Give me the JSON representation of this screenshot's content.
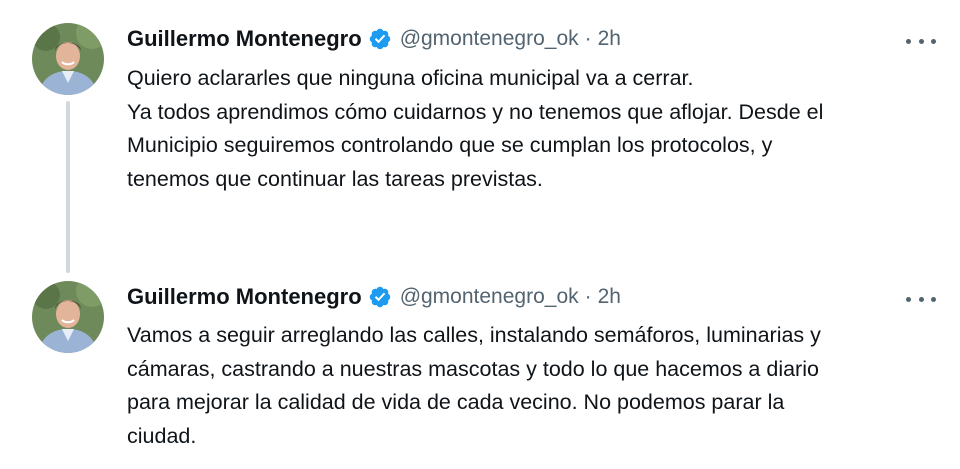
{
  "tweets": [
    {
      "author": {
        "name": "Guillermo Montenegro",
        "handle": "@gmontenegro_ok",
        "verified": true
      },
      "separator": "·",
      "time": "2h",
      "text_lines": [
        "Quiero aclararles que ninguna oficina municipal va a cerrar.",
        "Ya todos aprendimos cómo cuidarnos y no tenemos que aflojar. Desde el",
        "Municipio seguiremos controlando que se cumplan los protocolos, y",
        "tenemos que continuar las tareas previstas."
      ]
    },
    {
      "author": {
        "name": "Guillermo Montenegro",
        "handle": "@gmontenegro_ok",
        "verified": true
      },
      "separator": "·",
      "time": "2h",
      "text_lines": [
        "Vamos a seguir arreglando las calles, instalando semáforos, luminarias y",
        "cámaras, castrando a nuestras mascotas y todo lo que hacemos a diario",
        "para mejorar la calidad de vida de cada vecino. No podemos parar la",
        "ciudad."
      ]
    }
  ],
  "icons": {
    "avatar": "avatar-photo",
    "verified": "verified-badge-icon",
    "more": "more-options-icon"
  },
  "colors": {
    "text_primary": "#0f1419",
    "text_secondary": "#536471",
    "verified_blue": "#1d9bf0",
    "thread_line": "#cfd9de"
  }
}
